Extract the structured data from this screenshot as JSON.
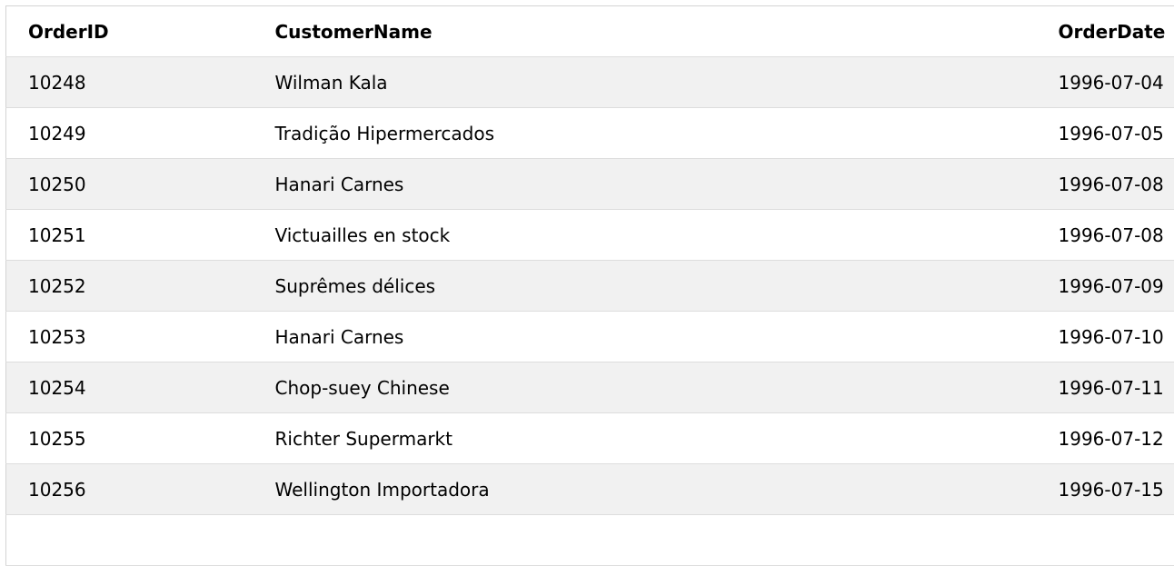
{
  "table": {
    "headers": [
      "OrderID",
      "CustomerName",
      "OrderDate"
    ],
    "rows": [
      [
        "10248",
        "Wilman Kala",
        "1996-07-04"
      ],
      [
        "10249",
        "Tradição Hipermercados",
        "1996-07-05"
      ],
      [
        "10250",
        "Hanari Carnes",
        "1996-07-08"
      ],
      [
        "10251",
        "Victuailles en stock",
        "1996-07-08"
      ],
      [
        "10252",
        "Suprêmes délices",
        "1996-07-09"
      ],
      [
        "10253",
        "Hanari Carnes",
        "1996-07-10"
      ],
      [
        "10254",
        "Chop-suey Chinese",
        "1996-07-11"
      ],
      [
        "10255",
        "Richter Supermarkt",
        "1996-07-12"
      ],
      [
        "10256",
        "Wellington Importadora",
        "1996-07-15"
      ]
    ]
  },
  "colors": {
    "stripe": "#f1f1f1",
    "border": "#dddddd"
  }
}
